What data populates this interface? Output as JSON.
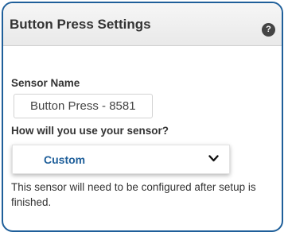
{
  "panel": {
    "title": "Button Press Settings",
    "help_icon": "help-icon",
    "help_glyph": "?",
    "accent_color": "#1f5f9a"
  },
  "fields": {
    "sensor_name_label": "Sensor Name",
    "sensor_name_value": "Button Press - 8581",
    "usage_label": "How will you use your sensor?",
    "usage_selected": "Custom",
    "dropdown_icon": "chevron-down-icon"
  },
  "note": "This sensor will need to be configured after setup is finished."
}
